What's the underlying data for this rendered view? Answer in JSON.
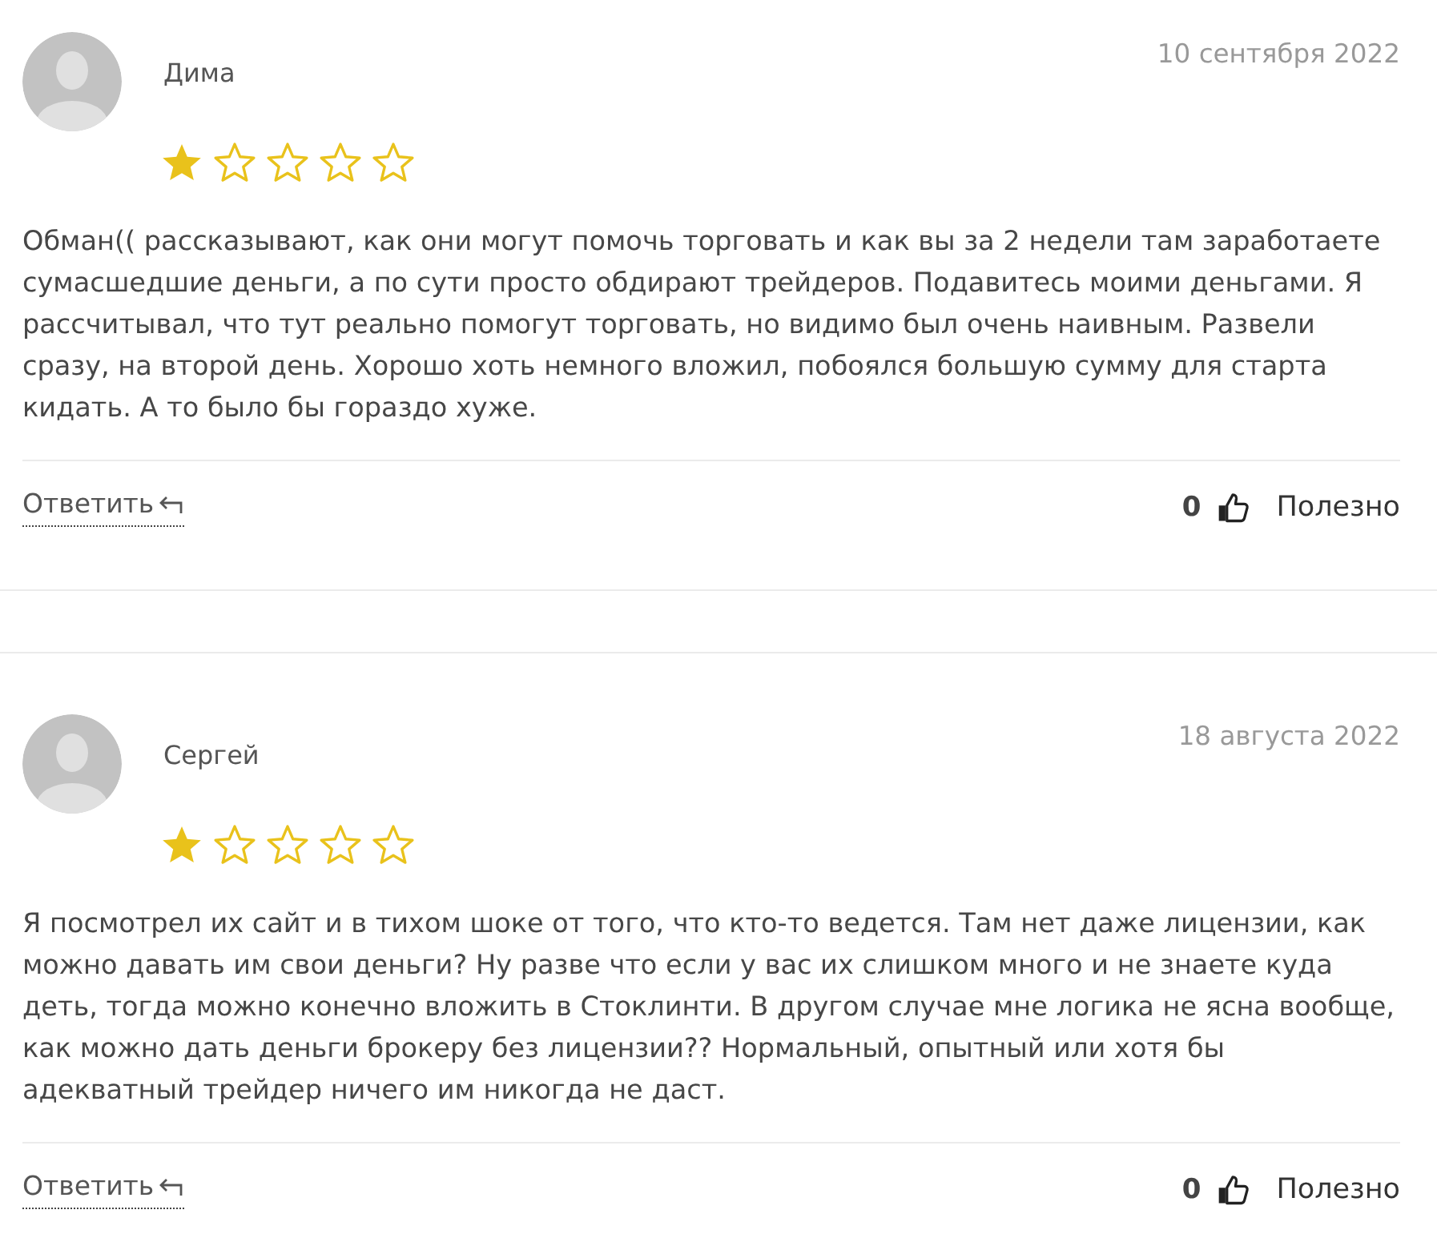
{
  "reviews": [
    {
      "author": "Дима",
      "date": "10 сентября 2022",
      "stars": 1,
      "text": "Обман(( рассказывают, как они могут помочь торговать и как вы за 2 недели там заработаете сумасшедшие деньги, а по сути просто обдирают трейдеров. Подавитесь моими деньгами. Я рассчитывал, что тут реально помогут торговать, но видимо был очень наивным. Развели сразу, на второй день. Хорошо хоть немного вложил, побоялся большую сумму для старта кидать. А то было бы гораздо хуже.",
      "reply": "Ответить",
      "likes": "0",
      "helpful": "Полезно"
    },
    {
      "author": "Сергей",
      "date": "18 августа 2022",
      "stars": 1,
      "text": "Я посмотрел их сайт и в тихом шоке от того, что кто-то ведется. Там нет даже лицензии, как можно давать им свои деньги? Ну разве что если у вас их слишком много и не знаете куда деть, тогда можно конечно вложить в Стоклинти. В другом случае мне логика не ясна вообще, как можно дать деньги брокеру без лицензии?? Нормальный, опытный или хотя бы адекватный трейдер ничего им никогда не даст.",
      "reply": "Ответить",
      "likes": "0",
      "helpful": "Полезно"
    }
  ]
}
